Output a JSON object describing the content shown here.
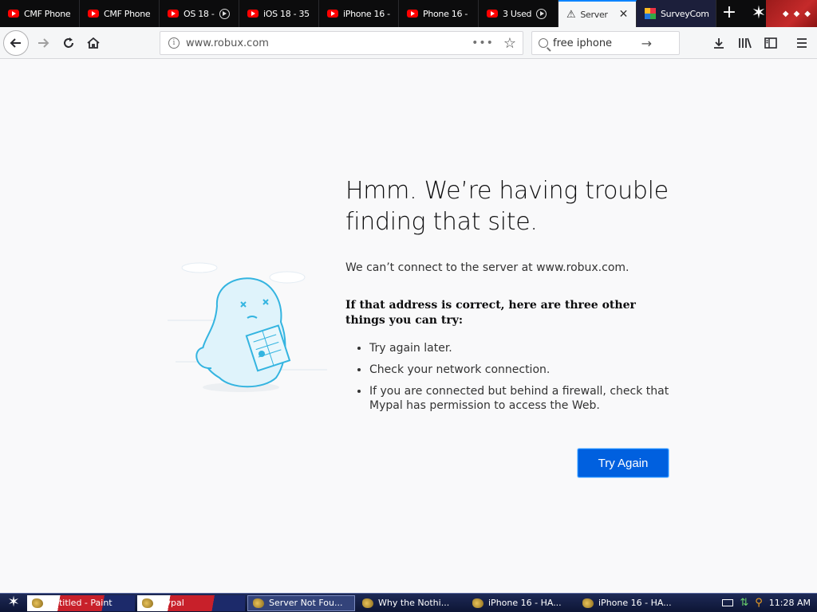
{
  "tabs": [
    {
      "title": "CMF Phone",
      "icon": "youtube-icon",
      "playing": false
    },
    {
      "title": "CMF Phone",
      "icon": "youtube-icon",
      "playing": false
    },
    {
      "title": "OS 18 -",
      "icon": "youtube-icon",
      "playing": true
    },
    {
      "title": "iOS 18 - 35",
      "icon": "youtube-icon",
      "playing": false
    },
    {
      "title": "iPhone 16 -",
      "icon": "youtube-icon",
      "playing": false
    },
    {
      "title": "Phone 16 -",
      "icon": "youtube-icon",
      "playing": false
    },
    {
      "title": "3 Used",
      "icon": "youtube-icon",
      "playing": true
    },
    {
      "title": "Server",
      "icon": "warning-icon",
      "active": true
    },
    {
      "title": "SurveyCom",
      "icon": "surveycompare-icon"
    }
  ],
  "window": {
    "close_tab_glyph": "✕",
    "new_tab_glyph": "+"
  },
  "navbar": {
    "url": "www.robux.com",
    "search_value": "free iphone",
    "page_actions_glyph": "•••"
  },
  "error": {
    "title": "Hmm. We’re having trouble finding that site.",
    "short_desc": "We can’t connect to the server at www.robux.com.",
    "long_title": "If that address is correct, here are three other things you can try:",
    "items": [
      "Try again later.",
      "Check your network connection.",
      "If you are connected but behind a firewall, check that Mypal has permission to access the Web."
    ],
    "try_again_label": "Try Again"
  },
  "taskbar": {
    "items": [
      {
        "label": "untitled - Paint",
        "style": "flag"
      },
      {
        "label": "Mypal",
        "style": "flag"
      },
      {
        "label": "Server Not Fou...",
        "style": "active"
      },
      {
        "label": "Why the Nothi...",
        "style": ""
      },
      {
        "label": "iPhone 16 - HA...",
        "style": ""
      },
      {
        "label": "iPhone 16 - HA...",
        "style": ""
      }
    ],
    "clock": "11:28 AM"
  },
  "colors": {
    "accent": "#0a84ff",
    "button": "#0060df",
    "tab_strip": "#0c0c0d",
    "page_bg": "#f9f9fa"
  }
}
